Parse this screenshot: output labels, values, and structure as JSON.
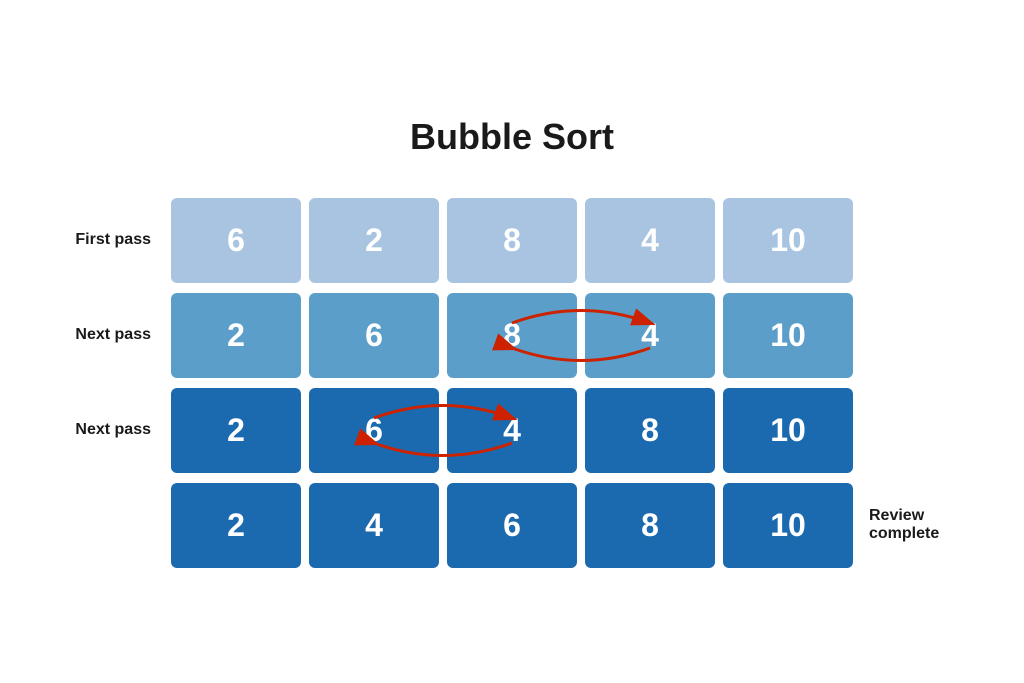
{
  "title": "Bubble Sort",
  "rows": [
    {
      "label": "First pass",
      "suffix": "",
      "cells": [
        6,
        2,
        8,
        4,
        10
      ],
      "shade": [
        "light",
        "light",
        "light",
        "light",
        "light"
      ],
      "arrows": null
    },
    {
      "label": "Next pass",
      "suffix": "",
      "cells": [
        2,
        6,
        8,
        4,
        10
      ],
      "shade": [
        "medium",
        "medium",
        "medium",
        "medium",
        "medium"
      ],
      "arrows": {
        "from": 2,
        "to": 3
      }
    },
    {
      "label": "Next pass",
      "suffix": "",
      "cells": [
        2,
        6,
        4,
        8,
        10
      ],
      "shade": [
        "dark",
        "dark",
        "dark",
        "dark",
        "dark"
      ],
      "arrows": {
        "from": 1,
        "to": 2
      }
    },
    {
      "label": "",
      "suffix": "Review complete",
      "cells": [
        2,
        4,
        6,
        8,
        10
      ],
      "shade": [
        "dark",
        "dark",
        "dark",
        "dark",
        "dark"
      ],
      "arrows": null
    }
  ],
  "colors": {
    "light": "#a8c4e0",
    "medium": "#5b9ec9",
    "dark": "#1b6aaf",
    "arrow": "#cc1111"
  }
}
